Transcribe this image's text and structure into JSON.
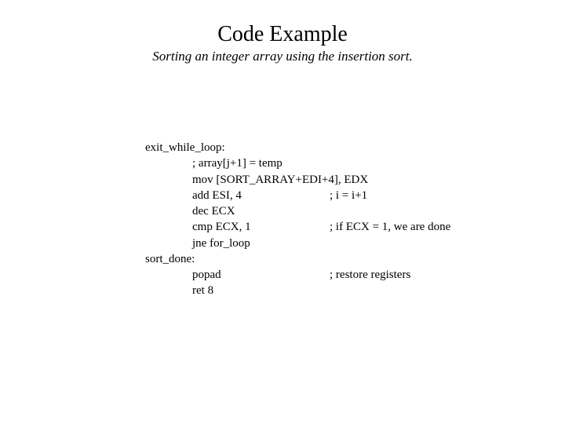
{
  "title": "Code Example",
  "subtitle": "Sorting an integer array using the insertion sort.",
  "code": {
    "label1": "exit_while_loop:",
    "l1_instr": "; array[j+1] = temp",
    "l2_instr": "mov [SORT_ARRAY+EDI+4], EDX",
    "l3_instr": "add ESI, 4",
    "l3_cmt": "; i = i+1",
    "l4_instr": "dec ECX",
    "l5_instr": "cmp ECX, 1",
    "l5_cmt": "; if ECX = 1, we are done",
    "l6_instr": "jne for_loop",
    "label2": "sort_done:",
    "l7_instr": "popad",
    "l7_cmt": "; restore registers",
    "l8_instr": "ret 8"
  }
}
